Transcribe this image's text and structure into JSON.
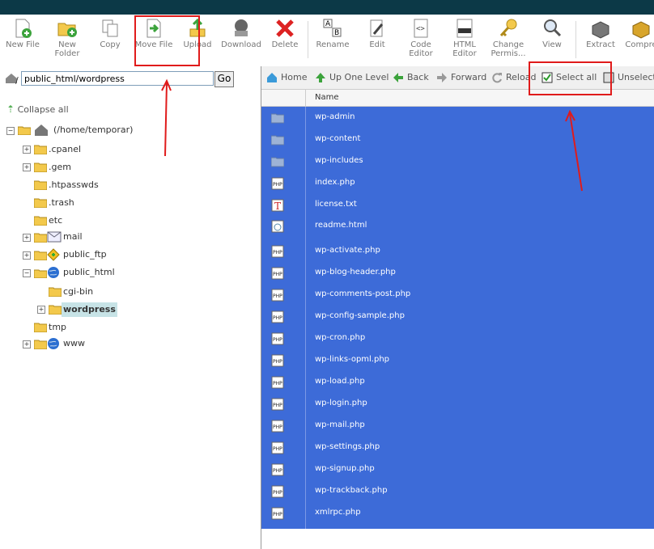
{
  "toolbar": {
    "buttons": [
      {
        "label": "New File"
      },
      {
        "label": "New\nFolder"
      },
      {
        "label": "Copy"
      },
      {
        "label": "Move File"
      },
      {
        "label": "Upload"
      },
      {
        "label": "Download"
      },
      {
        "label": "Delete"
      },
      {
        "label": "Rename"
      },
      {
        "label": "Edit"
      },
      {
        "label": "Code\nEditor"
      },
      {
        "label": "HTML\nEditor"
      },
      {
        "label": "Change\nPermis..."
      },
      {
        "label": "View"
      },
      {
        "label": "Extract"
      },
      {
        "label": "Compre"
      }
    ]
  },
  "address": {
    "value": "public_html/wordpress",
    "go_label": "Go"
  },
  "tree": {
    "collapse_label": "Collapse all",
    "root": "(/home/temporar)",
    "items": [
      ".cpanel",
      ".gem",
      ".htpasswds",
      ".trash",
      "etc",
      "mail",
      "public_ftp",
      "public_html",
      "cgi-bin",
      "wordpress",
      "tmp",
      "www"
    ]
  },
  "nav": {
    "home": "Home",
    "up": "Up One Level",
    "back": "Back",
    "forward": "Forward",
    "reload": "Reload",
    "select_all": "Select all",
    "unselect": "Unselect"
  },
  "files": {
    "column_name": "Name",
    "rows": [
      "wp-admin",
      "wp-content",
      "wp-includes",
      "index.php",
      "license.txt",
      "readme.html",
      "wp-activate.php",
      "wp-blog-header.php",
      "wp-comments-post.php",
      "wp-config-sample.php",
      "wp-cron.php",
      "wp-links-opml.php",
      "wp-load.php",
      "wp-login.php",
      "wp-mail.php",
      "wp-settings.php",
      "wp-signup.php",
      "wp-trackback.php",
      "xmlrpc.php"
    ]
  },
  "colors": {
    "selection": "#3d6bd8",
    "highlight": "#e01b1b",
    "topbar": "#0c3947"
  }
}
